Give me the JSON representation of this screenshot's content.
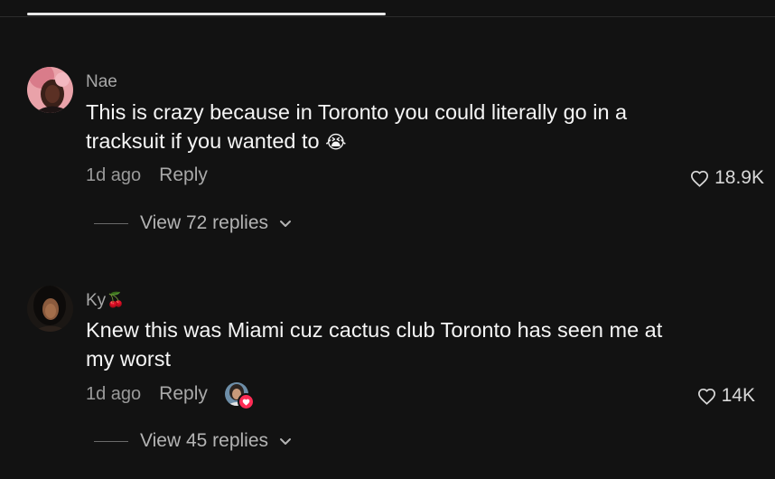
{
  "comments": [
    {
      "username": "Nae",
      "username_emoji": "",
      "text": "This is crazy because in Toronto you could literally go in a tracksuit if you wanted to",
      "text_emoji": "😭",
      "time": "1d ago",
      "reply_label": "Reply",
      "likes": "18.9K",
      "view_replies": "View 72 replies",
      "creator_liked": false
    },
    {
      "username": "Ky",
      "username_emoji": "🍒",
      "text": "Knew this was Miami cuz cactus club Toronto has seen me at my worst",
      "text_emoji": "",
      "time": "1d ago",
      "reply_label": "Reply",
      "likes": "14K",
      "view_replies": "View 45 replies",
      "creator_liked": true
    }
  ],
  "icons": {
    "like": "heart-outline-icon",
    "expand": "chevron-down-icon",
    "creator_like_badge": "heart-badge-icon"
  },
  "colors": {
    "background": "#121212",
    "accent": "#fe2c55",
    "secondary_text": "#a7a7a7"
  }
}
